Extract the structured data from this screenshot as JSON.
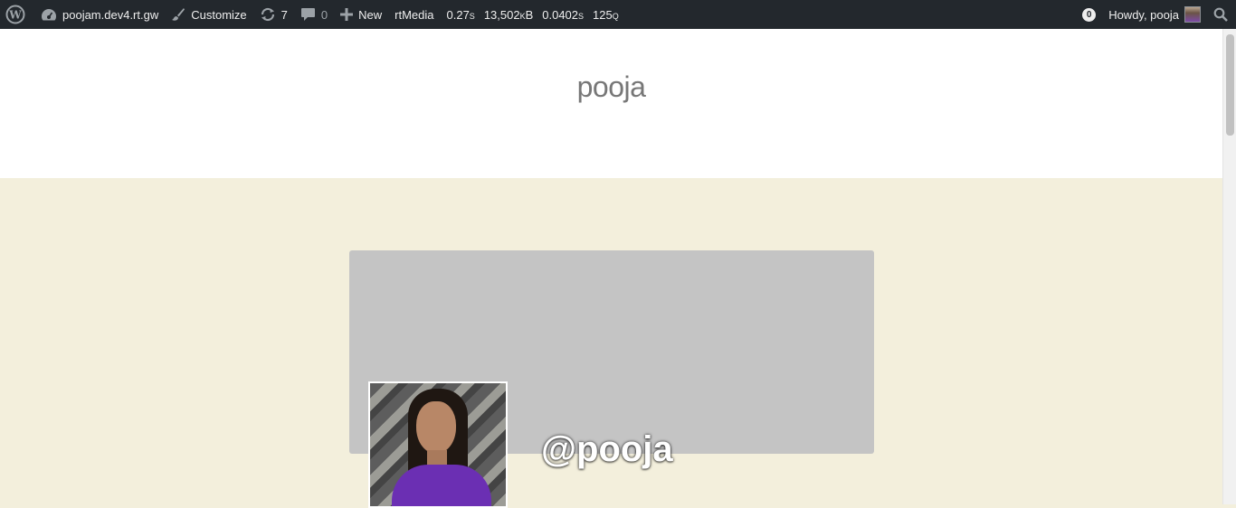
{
  "adminbar": {
    "wp_logo_icon": "wordpress-logo-icon",
    "site_name": "poojam.dev4.rt.gw",
    "customize": "Customize",
    "updates_count": "7",
    "comments_count": "0",
    "new_label": "New",
    "rtmedia": "rtMedia",
    "debug": {
      "time": "0.27s",
      "memory": "13,502kB",
      "query_time": "0.0402s",
      "queries": "125q"
    },
    "notifications": "0",
    "howdy": "Howdy, pooja"
  },
  "header": {
    "site_title": "pooja"
  },
  "profile": {
    "username": "@pooja"
  },
  "colors": {
    "adminbar_bg": "#23282d",
    "page_bg": "#f3efdc",
    "cover_bg": "#c4c4c4"
  }
}
